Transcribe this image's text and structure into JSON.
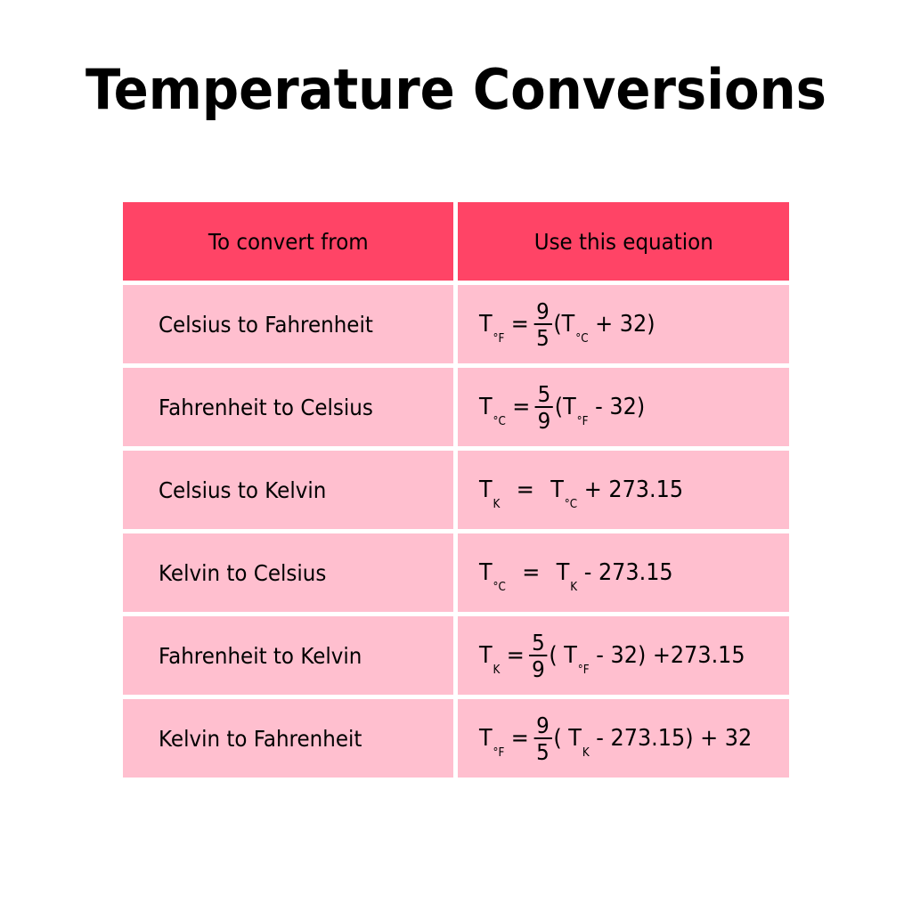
{
  "title": "Temperature Conversions",
  "colors": {
    "header_bg": "#ff4466",
    "row_bg": "#ffbfcf",
    "text": "#000000"
  },
  "table": {
    "headers": [
      "To convert from",
      "Use this equation"
    ],
    "rows": [
      {
        "from": "Celsius to Fahrenheit",
        "equation_text": "T°F = 9/5(T°C + 32)",
        "eq": {
          "lhs": "T",
          "lhs_sub": "°F",
          "eqsign": "=",
          "num": "9",
          "den": "5",
          "open": "(",
          "t2": "T",
          "t2_sub": "°C",
          "rest": " + 32)"
        }
      },
      {
        "from": "Fahrenheit to Celsius",
        "equation_text": "T°C = 5/9(T°F - 32)",
        "eq": {
          "lhs": "T",
          "lhs_sub": "°C",
          "eqsign": "=",
          "num": "5",
          "den": "9",
          "open": "(",
          "t2": "T",
          "t2_sub": "°F",
          "rest": " - 32)"
        }
      },
      {
        "from": "Celsius to Kelvin",
        "equation_text": "TK = T°C + 273.15",
        "eq": {
          "lhs": "T",
          "lhs_sub": "K",
          "eqsign": "=",
          "t2": "T",
          "t2_sub": "°C",
          "rest": " + 273.15"
        }
      },
      {
        "from": "Kelvin to Celsius",
        "equation_text": "T°C = TK - 273.15",
        "eq": {
          "lhs": "T",
          "lhs_sub": "°C",
          "eqsign": "=",
          "t2": "T",
          "t2_sub": "K",
          "rest": " - 273.15"
        }
      },
      {
        "from": "Fahrenheit to Kelvin",
        "equation_text": "TK = 5/9 ( T°F - 32) +273.15",
        "eq": {
          "lhs": "T",
          "lhs_sub": "K",
          "eqsign": "=",
          "num": "5",
          "den": "9",
          "open": "( ",
          "t2": "T",
          "t2_sub": "°F",
          "rest": " - 32) +273.15"
        }
      },
      {
        "from": "Kelvin to Fahrenheit",
        "equation_text": "T°F = 9/5 ( TK - 273.15) + 32",
        "eq": {
          "lhs": "T",
          "lhs_sub": "°F",
          "eqsign": "=",
          "num": "9",
          "den": "5",
          "open": "( ",
          "t2": "T",
          "t2_sub": "K",
          "rest": " - 273.15) + 32"
        }
      }
    ]
  }
}
